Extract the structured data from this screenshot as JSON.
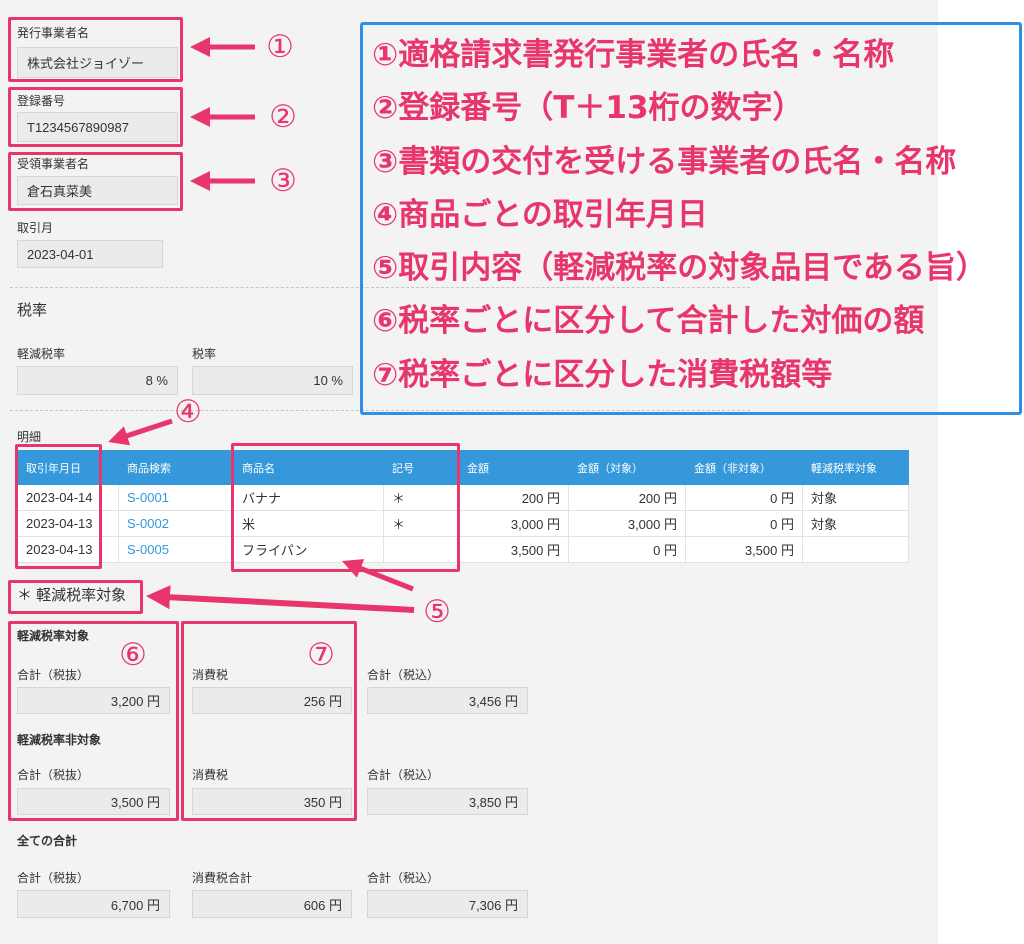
{
  "colors": {
    "accent_pink": "#e8366c",
    "annotation_blue": "#2f8fe6",
    "table_header_blue": "#3498db",
    "link_blue": "#3498db",
    "panel_gray": "#f3f3f3"
  },
  "form": {
    "issuer": {
      "label": "発行事業者名",
      "value": "株式会社ジョイゾー"
    },
    "registration_number": {
      "label": "登録番号",
      "value": "T1234567890987"
    },
    "recipient": {
      "label": "受領事業者名",
      "value": "倉石真菜美"
    },
    "transaction_month": {
      "label": "取引月",
      "value": "2023-04-01"
    }
  },
  "tax_rate": {
    "heading": "税率",
    "reduced": {
      "label": "軽減税率",
      "value": "8 %"
    },
    "standard": {
      "label": "税率",
      "value": "10 %"
    }
  },
  "details": {
    "label": "明細",
    "columns": [
      "取引年月日",
      "商品検索",
      "商品名",
      "記号",
      "金額",
      "金額（対象）",
      "金額（非対象）",
      "軽減税率対象"
    ],
    "rows": [
      {
        "date": "2023-04-14",
        "product_code": "S-0001",
        "product_name": "バナナ",
        "mark": "＊",
        "amount": "200 円",
        "amount_target": "200 円",
        "amount_non_target": "0 円",
        "reduced_target": "対象"
      },
      {
        "date": "2023-04-13",
        "product_code": "S-0002",
        "product_name": "米",
        "mark": "＊",
        "amount": "3,000 円",
        "amount_target": "3,000 円",
        "amount_non_target": "0 円",
        "reduced_target": "対象"
      },
      {
        "date": "2023-04-13",
        "product_code": "S-0005",
        "product_name": "フライパン",
        "mark": "",
        "amount": "3,500 円",
        "amount_target": "0 円",
        "amount_non_target": "3,500 円",
        "reduced_target": ""
      }
    ],
    "footnote": "＊ 軽減税率対象"
  },
  "totals": {
    "reduced": {
      "title": "軽減税率対象",
      "subtotal": {
        "label": "合計（税抜）",
        "value": "3,200 円"
      },
      "tax": {
        "label": "消費税",
        "value": "256 円"
      },
      "total": {
        "label": "合計（税込）",
        "value": "3,456 円"
      }
    },
    "standard": {
      "title": "軽減税率非対象",
      "subtotal": {
        "label": "合計（税抜）",
        "value": "3,500 円"
      },
      "tax": {
        "label": "消費税",
        "value": "350 円"
      },
      "total": {
        "label": "合計（税込）",
        "value": "3,850 円"
      }
    },
    "all": {
      "title": "全ての合計",
      "subtotal": {
        "label": "合計（税抜）",
        "value": "6,700 円"
      },
      "tax": {
        "label": "消費税合計",
        "value": "606 円"
      },
      "total": {
        "label": "合計（税込）",
        "value": "7,306 円"
      }
    }
  },
  "annotations": {
    "markers": [
      "①",
      "②",
      "③",
      "④",
      "⑤",
      "⑥",
      "⑦"
    ],
    "legend": [
      "①適格請求書発行事業者の氏名・名称",
      "②登録番号（T＋13桁の数字）",
      "③書類の交付を受ける事業者の氏名・名称",
      "④商品ごとの取引年月日",
      "⑤取引内容（軽減税率の対象品目である旨）",
      "⑥税率ごとに区分して合計した対価の額",
      "⑦税率ごとに区分した消費税額等"
    ]
  }
}
